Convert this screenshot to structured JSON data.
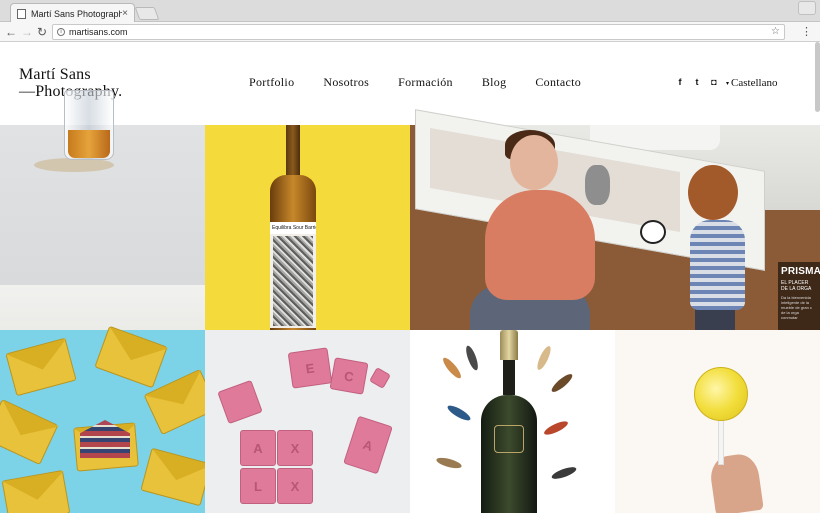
{
  "browser": {
    "tab_title": "Martí Sans Photography",
    "tab_close": "×",
    "url": "martisans.com",
    "info_glyph": "i",
    "back": "←",
    "forward": "→",
    "reload": "↻",
    "star": "☆",
    "menu": "⋮"
  },
  "site": {
    "logo_line1": "Martí Sans",
    "logo_line2": "—Photography.",
    "nav": [
      "Portfolio",
      "Nosotros",
      "Formación",
      "Blog",
      "Contacto"
    ],
    "social": {
      "facebook": "f",
      "twitter": "t",
      "instagram": "◘"
    },
    "language_caret": "▾",
    "language": "Castellano"
  },
  "gallery": {
    "bottle_label": "Equilibra Sour  Barrica",
    "ad_title": "PRISMA",
    "ad_subtitle_1": "EL PLACER",
    "ad_subtitle_2": "DE LA ORGA",
    "ad_body": [
      "Da la bienvenida",
      "inteligente de la",
      "mueble de gran c",
      "de la orga",
      "conmutar"
    ],
    "chocolate_letters": [
      "E",
      "C",
      "A",
      "X",
      "A",
      "L",
      "X"
    ]
  },
  "colors": {
    "yellow": "#f5da3b",
    "cyan": "#7cd2e6",
    "pink": "#e07a9a"
  }
}
